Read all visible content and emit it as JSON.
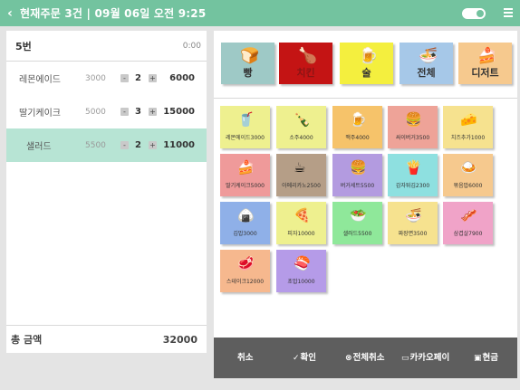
{
  "header": {
    "back_icon": "chevron-left-icon",
    "title": "현재주문 3건 | 09월 06일 오전 9:25",
    "toggle_on": true,
    "menu_icon": "hamburger-menu-icon"
  },
  "order": {
    "table_no": "5번",
    "time": "0:00",
    "rows": [
      {
        "name": "레몬에이드",
        "price": "3000",
        "qty": "2",
        "total": "6000",
        "selected": false
      },
      {
        "name": "딸기케이크",
        "price": "5000",
        "qty": "3",
        "total": "15000",
        "selected": false
      },
      {
        "name": "샐러드",
        "price": "5500",
        "qty": "2",
        "total": "11000",
        "selected": true
      }
    ],
    "minus": "-",
    "plus": "+",
    "total_label": "총 금액",
    "total_value": "32000"
  },
  "categories": [
    {
      "label": "빵",
      "icon": "bread-icon",
      "glyph": "🍞",
      "color": "#9ec9c6"
    },
    {
      "label": "치킨",
      "icon": "chicken-icon",
      "glyph": "🍗",
      "color": "#c41414"
    },
    {
      "label": "술",
      "icon": "beer-icon",
      "glyph": "🍺",
      "color": "#f4ef3e"
    },
    {
      "label": "전체",
      "icon": "noodle-bowl-icon",
      "glyph": "🍜",
      "color": "#a6c8e8"
    },
    {
      "label": "디저트",
      "icon": "cake-icon",
      "glyph": "🍰",
      "color": "#f6c98e"
    }
  ],
  "items": [
    {
      "label": "레몬에이드3000",
      "icon": "lemonade-icon",
      "glyph": "🥤",
      "color": "#eef08f"
    },
    {
      "label": "소주4000",
      "icon": "soju-bottle-icon",
      "glyph": "🍾",
      "color": "#eef08f"
    },
    {
      "label": "맥주4000",
      "icon": "beer-icon",
      "glyph": "🍺",
      "color": "#f6c36a"
    },
    {
      "label": "싸이버거3500",
      "icon": "burger-icon",
      "glyph": "🍔",
      "color": "#eea398"
    },
    {
      "label": "치즈추가1000",
      "icon": "cheese-icon",
      "glyph": "🧀",
      "color": "#f6e28f"
    },
    {
      "label": "딸기케이크5000",
      "icon": "cake-icon",
      "glyph": "🍰",
      "color": "#ef9a9a"
    },
    {
      "label": "아메리카노2500",
      "icon": "coffee-icon",
      "glyph": "☕",
      "color": "#b59e87"
    },
    {
      "label": "버거세트5500",
      "icon": "burger-set-icon",
      "glyph": "🍔",
      "color": "#b39be0"
    },
    {
      "label": "감자튀김2300",
      "icon": "fries-icon",
      "glyph": "🍟",
      "color": "#8ee0e0"
    },
    {
      "label": "볶음밥6000",
      "icon": "fried-rice-icon",
      "glyph": "🍛",
      "color": "#f6c98e"
    },
    {
      "label": "김밥3000",
      "icon": "kimbap-icon",
      "glyph": "🍙",
      "color": "#8fb0e8"
    },
    {
      "label": "피자10000",
      "icon": "pizza-icon",
      "glyph": "🍕",
      "color": "#eef08f"
    },
    {
      "label": "샐러드5500",
      "icon": "salad-icon",
      "glyph": "🥗",
      "color": "#8fe89a"
    },
    {
      "label": "짜장면3500",
      "icon": "jjajangmyeon-icon",
      "glyph": "🍜",
      "color": "#f6e28f"
    },
    {
      "label": "삼겹살7900",
      "icon": "pork-belly-icon",
      "glyph": "🥓",
      "color": "#f0a3c8"
    },
    {
      "label": "스테이크12000",
      "icon": "steak-icon",
      "glyph": "🥩",
      "color": "#f6b88e"
    },
    {
      "label": "초밥10000",
      "icon": "sushi-icon",
      "glyph": "🍣",
      "color": "#b59be8"
    }
  ],
  "actions": [
    {
      "label": "취소",
      "icon": "",
      "glyph": ""
    },
    {
      "label": "확인",
      "icon": "check-circle-icon",
      "glyph": "✓"
    },
    {
      "label": "전체취소",
      "icon": "cancel-circle-icon",
      "glyph": "⊗"
    },
    {
      "label": "카카오페이",
      "icon": "card-icon",
      "glyph": "▭"
    },
    {
      "label": "현금",
      "icon": "cash-icon",
      "glyph": "▣"
    }
  ]
}
